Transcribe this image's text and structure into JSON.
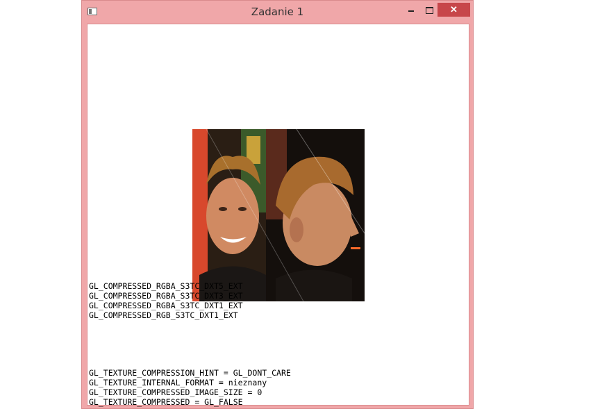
{
  "window": {
    "title": "Zadanie 1",
    "icon": "app-window-icon",
    "controls": {
      "minimize_icon": "minimize-icon",
      "maximize_icon": "maximize-icon",
      "close_label": "✕"
    }
  },
  "texture_image": {
    "description_icon": "photo-texture",
    "panels": [
      "front-face",
      "side-profile"
    ]
  },
  "compressed_formats": [
    "GL_COMPRESSED_RGBA_S3TC_DXT5_EXT",
    "GL_COMPRESSED_RGBA_S3TC_DXT3_EXT",
    "GL_COMPRESSED_RGBA_S3TC_DXT1_EXT",
    "GL_COMPRESSED_RGB_S3TC_DXT1_EXT"
  ],
  "texture_params": [
    "GL_TEXTURE_COMPRESSION_HINT = GL_DONT_CARE",
    "GL_TEXTURE_INTERNAL_FORMAT = nieznany",
    "GL_TEXTURE_COMPRESSED_IMAGE_SIZE = 0",
    "GL_TEXTURE_COMPRESSED = GL_FALSE"
  ],
  "colors": {
    "frame": "#f0a7a9",
    "close_button": "#c7464a"
  }
}
